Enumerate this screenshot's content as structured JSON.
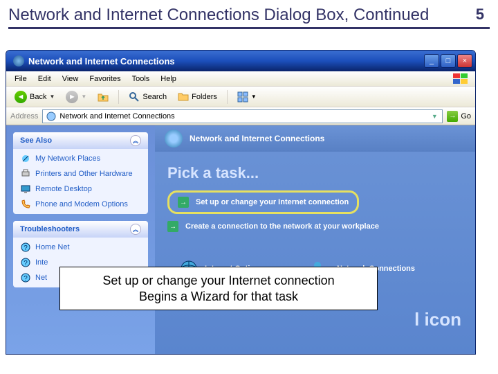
{
  "slide": {
    "title": "Network and Internet Connections Dialog Box, Continued",
    "number": "5"
  },
  "window": {
    "title": "Network and Internet Connections"
  },
  "menubar": {
    "items": [
      "File",
      "Edit",
      "View",
      "Favorites",
      "Tools",
      "Help"
    ]
  },
  "toolbar": {
    "back": "Back",
    "search": "Search",
    "folders": "Folders"
  },
  "addressbar": {
    "label": "Address",
    "value": "Network and Internet Connections",
    "go": "Go"
  },
  "sidebar": {
    "see_also": {
      "title": "See Also",
      "items": [
        "My Network Places",
        "Printers and Other Hardware",
        "Remote Desktop",
        "Phone and Modem Options"
      ]
    },
    "troubleshooters": {
      "title": "Troubleshooters",
      "items": [
        "Home Net",
        "Inte",
        "Net"
      ]
    }
  },
  "main": {
    "header": "Network and Internet Connections",
    "pick_task": "Pick a task...",
    "tasks": [
      "Set up or change your Internet connection",
      "Create a connection to the network at your workplace"
    ],
    "pick_icon_partial": "l icon",
    "cp_icons": [
      "Internet Options",
      "Network Connections"
    ]
  },
  "callout": {
    "line1": "Set up or change your Internet connection",
    "line2": "Begins a Wizard for that task"
  }
}
